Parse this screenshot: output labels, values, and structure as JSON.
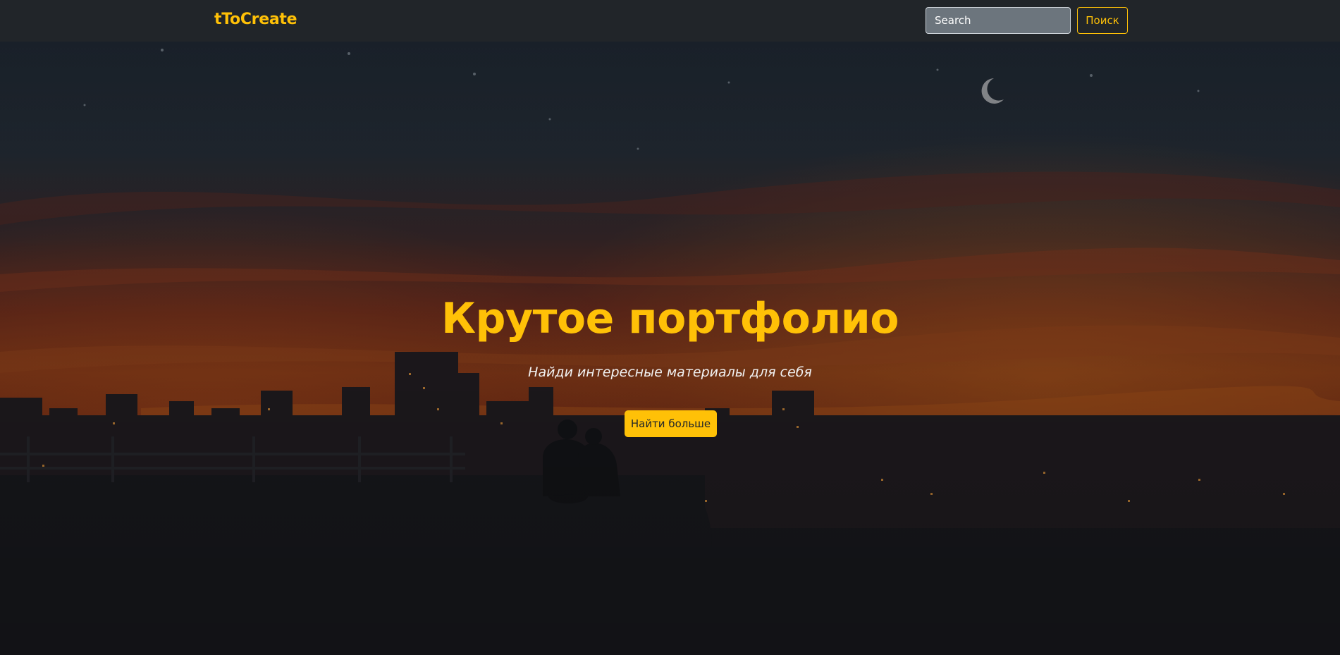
{
  "navbar": {
    "brand": "tToCreate",
    "search_placeholder": "Search",
    "search_button": "Поиск"
  },
  "hero": {
    "title": "Крутое портфолио",
    "subtitle": "Найди интересные материалы для себя",
    "button": "Найти больше",
    "background": "night-city-skyline-illustration"
  },
  "colors": {
    "accent": "#ffc107",
    "navbar_bg": "#212529",
    "search_bg": "#6c757d"
  }
}
